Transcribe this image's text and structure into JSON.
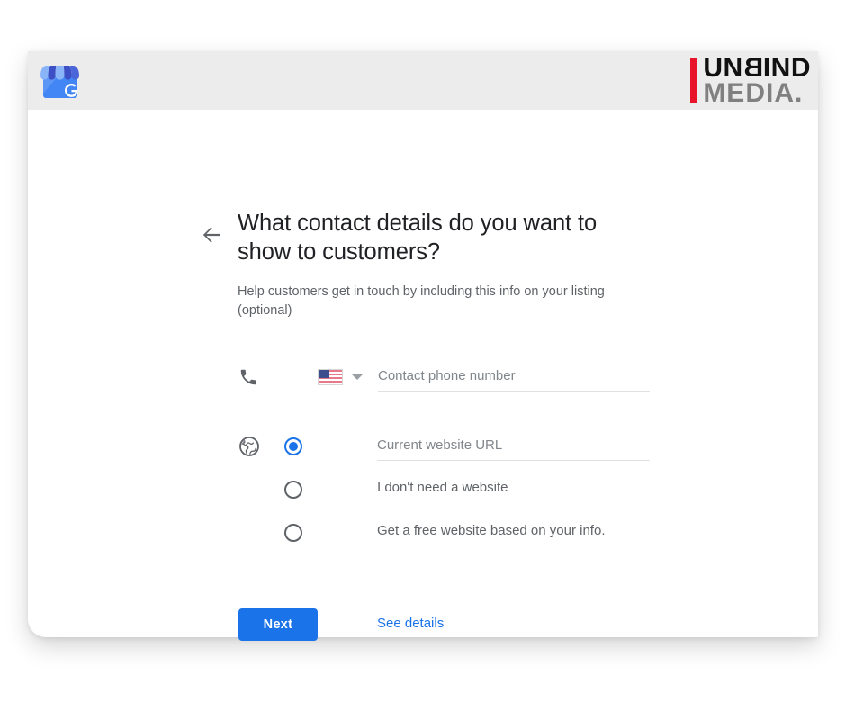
{
  "header": {
    "app_icon": "google-my-business-storefront-icon",
    "brand": {
      "line1_pre": "UN",
      "line1_b": "B",
      "line1_post": "IND",
      "line2": "MEDIA.",
      "accent_color": "#e8142a",
      "line1_color": "#111111",
      "line2_color": "#808080"
    },
    "bar_color": "#ececec"
  },
  "main": {
    "back_icon": "back-arrow-icon",
    "headline": "What contact details do you want to show to customers?",
    "subhead": "Help customers get in touch by including this info on your listing (optional)",
    "phone": {
      "icon": "phone-icon",
      "flag": "us-flag-icon",
      "caret": "chevron-down-icon",
      "value": "",
      "placeholder": "Contact phone number"
    },
    "website": {
      "icon": "globe-icon",
      "options": [
        {
          "id": "current-url",
          "type": "input",
          "selected": true,
          "value": "",
          "placeholder": "Current website URL"
        },
        {
          "id": "no-website",
          "type": "label",
          "selected": false,
          "label": "I don't need a website"
        },
        {
          "id": "free-website",
          "type": "label",
          "selected": false,
          "label": "Get a free website based on your info."
        }
      ],
      "see_details": "See details",
      "link_color": "#1a73e8"
    },
    "next_label": "Next",
    "accent_color": "#1a73e8"
  }
}
